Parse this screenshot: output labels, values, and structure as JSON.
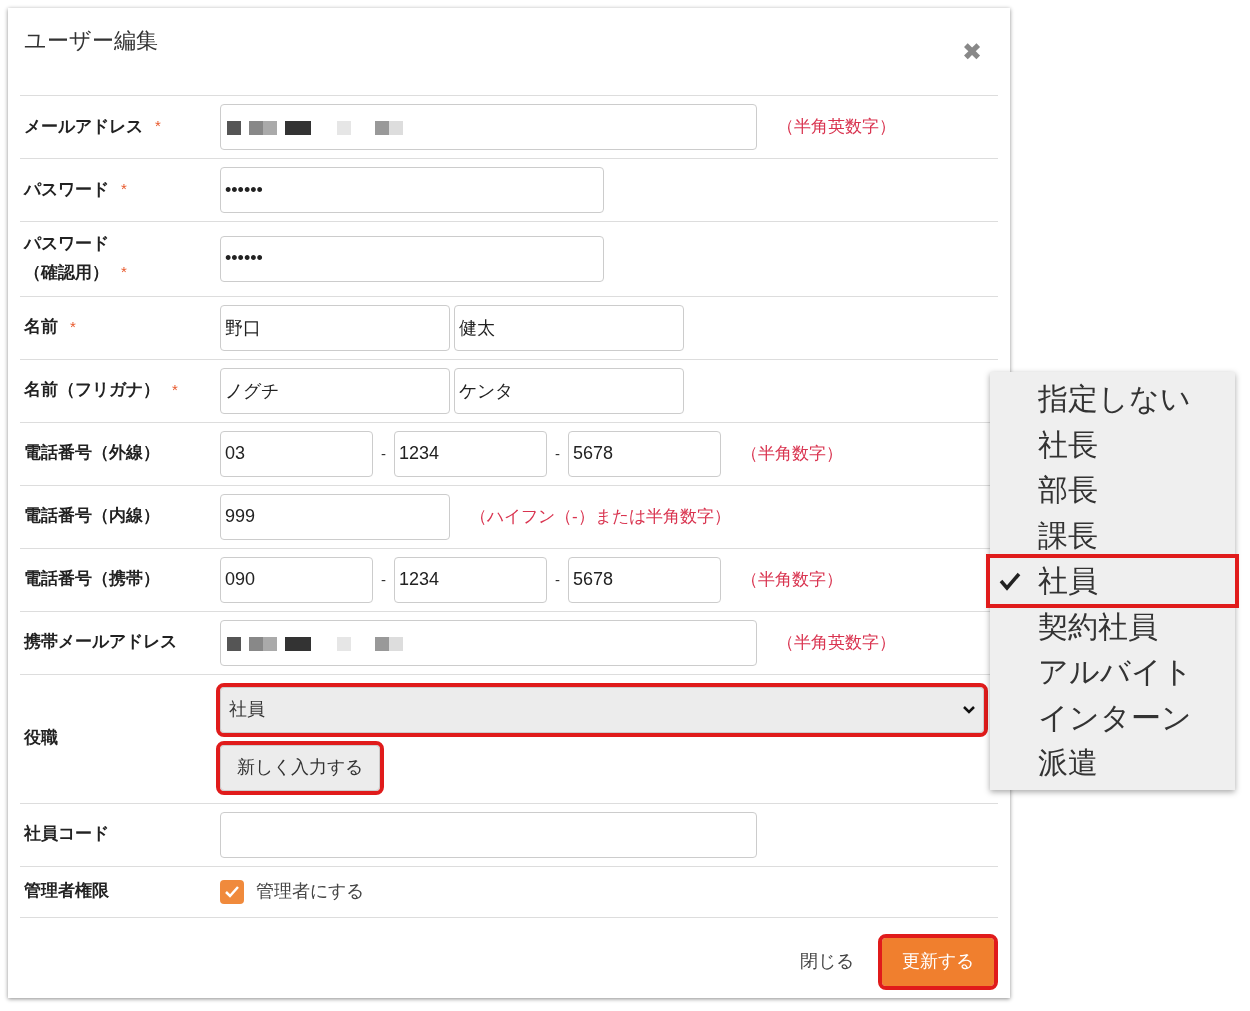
{
  "dialog": {
    "title": "ユーザー編集",
    "close": "✖"
  },
  "fields": [
    {
      "kind": "wide",
      "label": [
        "メールアドレス"
      ],
      "required_mark": "*",
      "inputs": [
        {
          "redacted": true
        }
      ],
      "hint": "（半角英数字）"
    },
    {
      "kind": "medium",
      "label": [
        "パスワード"
      ],
      "required_mark": "*",
      "inputs": [
        {
          "value": "••••••"
        }
      ]
    },
    {
      "kind": "medium",
      "label": [
        "パスワード",
        "（確認用）"
      ],
      "required_mark": "*",
      "inputs": [
        {
          "value": "••••••"
        }
      ]
    },
    {
      "kind": "half",
      "label": [
        "名前"
      ],
      "required_mark": "*",
      "inputs": [
        {
          "value": "野口"
        },
        {
          "value": "健太"
        }
      ]
    },
    {
      "kind": "half",
      "label": [
        "名前（フリガナ）"
      ],
      "required_mark": "*",
      "inputs": [
        {
          "value": "ノグチ"
        },
        {
          "value": "ケンタ"
        }
      ]
    },
    {
      "kind": "third",
      "label": [
        "電話番号（外線）"
      ],
      "inputs": [
        {
          "value": "03"
        },
        {
          "prefix": "-",
          "value": "1234"
        },
        {
          "prefix": "-",
          "value": "5678"
        }
      ],
      "hint": "（半角数字）"
    },
    {
      "kind": "half",
      "label": [
        "電話番号（内線）"
      ],
      "inputs": [
        {
          "value": "999"
        }
      ],
      "hint": "（ハイフン（-）または半角数字）"
    },
    {
      "kind": "third",
      "label": [
        "電話番号（携帯）"
      ],
      "inputs": [
        {
          "value": "090"
        },
        {
          "prefix": "-",
          "value": "1234"
        },
        {
          "prefix": "-",
          "value": "5678"
        }
      ],
      "hint": "（半角数字）"
    },
    {
      "kind": "wide",
      "label": [
        "携帯メールアドレス"
      ],
      "inputs": [
        {
          "redacted": true
        }
      ],
      "hint": "（半角英数字）"
    },
    {
      "kind": "select",
      "label": [
        "役職"
      ],
      "value": "社員",
      "highlighted": true,
      "button": {
        "label": "新しく入力する",
        "highlighted": true
      }
    },
    {
      "kind": "wide",
      "label": [
        "社員コード"
      ],
      "inputs": [
        {
          "redacted": false
        }
      ]
    },
    {
      "kind": "checkbox",
      "label": [
        "管理者権限"
      ],
      "checked": true,
      "text": "管理者にする"
    }
  ],
  "footer": {
    "close": "閉じる",
    "submit": {
      "label": "更新する",
      "highlighted": true
    }
  },
  "dropdown": {
    "options": [
      {
        "label": "指定しない",
        "selected": false,
        "highlighted": false
      },
      {
        "label": "社長",
        "selected": false,
        "highlighted": false
      },
      {
        "label": "部長",
        "selected": false,
        "highlighted": false
      },
      {
        "label": "課長",
        "selected": false,
        "highlighted": false
      },
      {
        "label": "社員",
        "selected": true,
        "highlighted": true
      },
      {
        "label": "契約社員",
        "selected": false,
        "highlighted": false
      },
      {
        "label": "アルバイト",
        "selected": false,
        "highlighted": false
      },
      {
        "label": "インターン",
        "selected": false,
        "highlighted": false
      },
      {
        "label": "派遣",
        "selected": false,
        "highlighted": false
      }
    ]
  }
}
